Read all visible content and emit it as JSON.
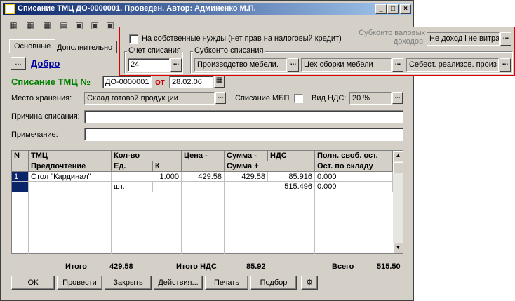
{
  "window": {
    "title": "Списание ТМЦ ДО-0000001. Проведен. Автор: Админенко М.П."
  },
  "tabs": [
    {
      "label": "Основные"
    },
    {
      "label": "Дополнительно"
    }
  ],
  "header": {
    "link_label": "Добро",
    "doc_title": "Списание ТМЦ №",
    "doc_number": "ДО-0000001",
    "date_prefix": "от",
    "doc_date": "28.02.06"
  },
  "form": {
    "storage_label": "Место хранения:",
    "storage_value": "Склад готовой продукции",
    "mbp_label": "Списание МБП",
    "vat_label": "Вид НДС:",
    "vat_value": "20 %",
    "reason_label": "Причина списания:",
    "reason_value": "",
    "note_label": "Примечание:",
    "note_value": ""
  },
  "callout": {
    "own_needs_label": "На собственные нужды (нет прав на налоговый кредит)",
    "subconto_vat_label": "Субконто валовых доходов:",
    "subconto_vat_value": "Не доход і не витра",
    "account_group": "Счет списания",
    "account_value": "24",
    "subconto_group": "Субконто списания",
    "subconto1": "Производство мебели.",
    "subconto2": "Цех сборки мебели",
    "subconto3": "Себест. реализов. произ"
  },
  "grid": {
    "headers": {
      "n": "N",
      "tmc": "ТМЦ",
      "pref": "Предпочтение",
      "qty": "Кол-во",
      "unit": "Ед.",
      "k": "К",
      "price": "Цена -",
      "sum_minus": "Сумма -",
      "vat": "НДС",
      "sum_plus": "Сумма +",
      "free_rest": "Полн. своб. ост.",
      "stock_rest": "Ост. по складу"
    },
    "rows": [
      {
        "n": "1",
        "tmc": "Стол \"Кардинал\"",
        "qty": "1.000",
        "unit": "шт.",
        "k": "1.000",
        "price": "429.58",
        "sum_minus": "429.58",
        "vat": "85.916",
        "sum_plus": "515.496",
        "free_rest": "0.000",
        "stock_rest": "0.000"
      }
    ]
  },
  "totals": {
    "total_label": "Итого",
    "total_value": "429.58",
    "vat_label": "Итого НДС",
    "vat_value": "85.92",
    "all_label": "Всего",
    "all_value": "515.50"
  },
  "buttons": {
    "ok": "ОК",
    "post": "Провести",
    "close": "Закрыть",
    "actions": "Действия...",
    "print": "Печать",
    "select": "Подбор"
  },
  "colors": {
    "title_start": "#0a246a",
    "title_end": "#a6caf0",
    "face": "#d4d0c8",
    "callout_border": "#e00000",
    "doc_title_green": "#008000",
    "doc_number_red": "#c00000"
  }
}
